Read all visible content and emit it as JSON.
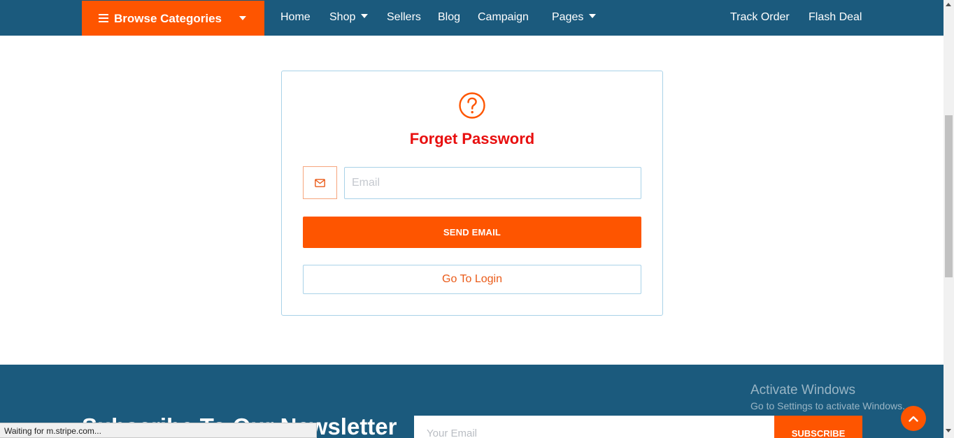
{
  "nav": {
    "browse_label": "Browse Categories",
    "links": [
      {
        "label": "Home",
        "dropdown": false
      },
      {
        "label": "Shop",
        "dropdown": true
      },
      {
        "label": "Sellers",
        "dropdown": false
      },
      {
        "label": "Blog",
        "dropdown": false
      },
      {
        "label": "Campaign",
        "dropdown": false
      },
      {
        "label": "Pages",
        "dropdown": true
      }
    ],
    "right_links": [
      "Track Order",
      "Flash Deal"
    ],
    "icons": {
      "menu": "hamburger-menu-icon",
      "dropdown": "caret-down-icon"
    }
  },
  "forget": {
    "icon": "question-circle-icon",
    "title": "Forget Password",
    "email_icon": "envelope-icon",
    "email_placeholder": "Email",
    "email_value": "",
    "send_label": "SEND EMAIL",
    "login_label": "Go To Login"
  },
  "newsletter": {
    "title": "Subscribe To Our Newsletter",
    "email_placeholder": "Your Email",
    "subscribe_label": "SUBSCRIBE"
  },
  "watermark": {
    "line1": "Activate Windows",
    "line2": "Go to Settings to activate Windows."
  },
  "status_bar": "Waiting for m.stripe.com...",
  "colors": {
    "nav_bg": "#1b5a7d",
    "accent": "#fe5500",
    "title_red": "#e80f0f",
    "border_blue": "#a9d2e8"
  }
}
